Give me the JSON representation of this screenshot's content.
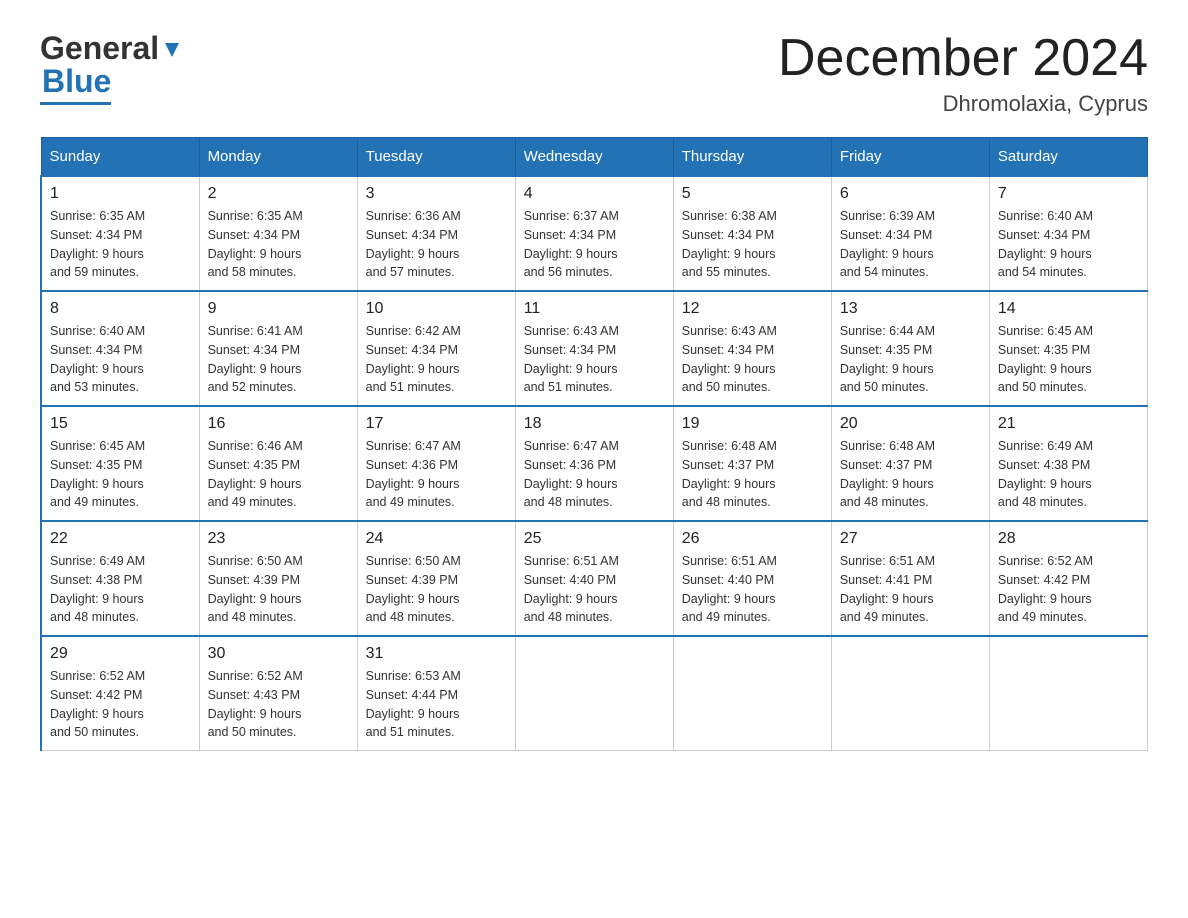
{
  "header": {
    "logo_general": "General",
    "logo_blue": "Blue",
    "month_title": "December 2024",
    "location": "Dhromolaxia, Cyprus"
  },
  "weekdays": [
    "Sunday",
    "Monday",
    "Tuesday",
    "Wednesday",
    "Thursday",
    "Friday",
    "Saturday"
  ],
  "weeks": [
    [
      {
        "day": "1",
        "sunrise": "6:35 AM",
        "sunset": "4:34 PM",
        "daylight": "9 hours and 59 minutes."
      },
      {
        "day": "2",
        "sunrise": "6:35 AM",
        "sunset": "4:34 PM",
        "daylight": "9 hours and 58 minutes."
      },
      {
        "day": "3",
        "sunrise": "6:36 AM",
        "sunset": "4:34 PM",
        "daylight": "9 hours and 57 minutes."
      },
      {
        "day": "4",
        "sunrise": "6:37 AM",
        "sunset": "4:34 PM",
        "daylight": "9 hours and 56 minutes."
      },
      {
        "day": "5",
        "sunrise": "6:38 AM",
        "sunset": "4:34 PM",
        "daylight": "9 hours and 55 minutes."
      },
      {
        "day": "6",
        "sunrise": "6:39 AM",
        "sunset": "4:34 PM",
        "daylight": "9 hours and 54 minutes."
      },
      {
        "day": "7",
        "sunrise": "6:40 AM",
        "sunset": "4:34 PM",
        "daylight": "9 hours and 54 minutes."
      }
    ],
    [
      {
        "day": "8",
        "sunrise": "6:40 AM",
        "sunset": "4:34 PM",
        "daylight": "9 hours and 53 minutes."
      },
      {
        "day": "9",
        "sunrise": "6:41 AM",
        "sunset": "4:34 PM",
        "daylight": "9 hours and 52 minutes."
      },
      {
        "day": "10",
        "sunrise": "6:42 AM",
        "sunset": "4:34 PM",
        "daylight": "9 hours and 51 minutes."
      },
      {
        "day": "11",
        "sunrise": "6:43 AM",
        "sunset": "4:34 PM",
        "daylight": "9 hours and 51 minutes."
      },
      {
        "day": "12",
        "sunrise": "6:43 AM",
        "sunset": "4:34 PM",
        "daylight": "9 hours and 50 minutes."
      },
      {
        "day": "13",
        "sunrise": "6:44 AM",
        "sunset": "4:35 PM",
        "daylight": "9 hours and 50 minutes."
      },
      {
        "day": "14",
        "sunrise": "6:45 AM",
        "sunset": "4:35 PM",
        "daylight": "9 hours and 50 minutes."
      }
    ],
    [
      {
        "day": "15",
        "sunrise": "6:45 AM",
        "sunset": "4:35 PM",
        "daylight": "9 hours and 49 minutes."
      },
      {
        "day": "16",
        "sunrise": "6:46 AM",
        "sunset": "4:35 PM",
        "daylight": "9 hours and 49 minutes."
      },
      {
        "day": "17",
        "sunrise": "6:47 AM",
        "sunset": "4:36 PM",
        "daylight": "9 hours and 49 minutes."
      },
      {
        "day": "18",
        "sunrise": "6:47 AM",
        "sunset": "4:36 PM",
        "daylight": "9 hours and 48 minutes."
      },
      {
        "day": "19",
        "sunrise": "6:48 AM",
        "sunset": "4:37 PM",
        "daylight": "9 hours and 48 minutes."
      },
      {
        "day": "20",
        "sunrise": "6:48 AM",
        "sunset": "4:37 PM",
        "daylight": "9 hours and 48 minutes."
      },
      {
        "day": "21",
        "sunrise": "6:49 AM",
        "sunset": "4:38 PM",
        "daylight": "9 hours and 48 minutes."
      }
    ],
    [
      {
        "day": "22",
        "sunrise": "6:49 AM",
        "sunset": "4:38 PM",
        "daylight": "9 hours and 48 minutes."
      },
      {
        "day": "23",
        "sunrise": "6:50 AM",
        "sunset": "4:39 PM",
        "daylight": "9 hours and 48 minutes."
      },
      {
        "day": "24",
        "sunrise": "6:50 AM",
        "sunset": "4:39 PM",
        "daylight": "9 hours and 48 minutes."
      },
      {
        "day": "25",
        "sunrise": "6:51 AM",
        "sunset": "4:40 PM",
        "daylight": "9 hours and 48 minutes."
      },
      {
        "day": "26",
        "sunrise": "6:51 AM",
        "sunset": "4:40 PM",
        "daylight": "9 hours and 49 minutes."
      },
      {
        "day": "27",
        "sunrise": "6:51 AM",
        "sunset": "4:41 PM",
        "daylight": "9 hours and 49 minutes."
      },
      {
        "day": "28",
        "sunrise": "6:52 AM",
        "sunset": "4:42 PM",
        "daylight": "9 hours and 49 minutes."
      }
    ],
    [
      {
        "day": "29",
        "sunrise": "6:52 AM",
        "sunset": "4:42 PM",
        "daylight": "9 hours and 50 minutes."
      },
      {
        "day": "30",
        "sunrise": "6:52 AM",
        "sunset": "4:43 PM",
        "daylight": "9 hours and 50 minutes."
      },
      {
        "day": "31",
        "sunrise": "6:53 AM",
        "sunset": "4:44 PM",
        "daylight": "9 hours and 51 minutes."
      },
      null,
      null,
      null,
      null
    ]
  ],
  "labels": {
    "sunrise_label": "Sunrise:",
    "sunset_label": "Sunset:",
    "daylight_label": "Daylight:"
  }
}
